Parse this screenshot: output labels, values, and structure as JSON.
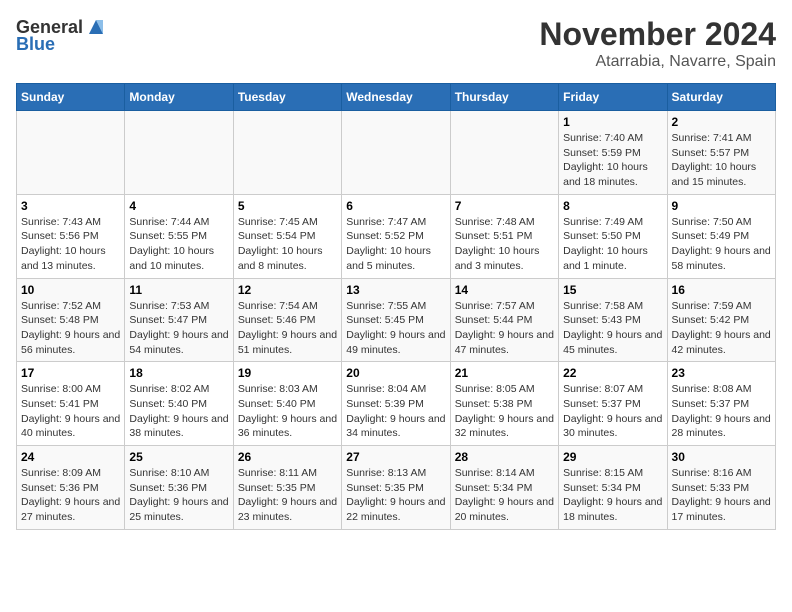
{
  "header": {
    "logo_general": "General",
    "logo_blue": "Blue",
    "month": "November 2024",
    "location": "Atarrabia, Navarre, Spain"
  },
  "weekdays": [
    "Sunday",
    "Monday",
    "Tuesday",
    "Wednesday",
    "Thursday",
    "Friday",
    "Saturday"
  ],
  "weeks": [
    [
      {
        "day": "",
        "info": ""
      },
      {
        "day": "",
        "info": ""
      },
      {
        "day": "",
        "info": ""
      },
      {
        "day": "",
        "info": ""
      },
      {
        "day": "",
        "info": ""
      },
      {
        "day": "1",
        "info": "Sunrise: 7:40 AM\nSunset: 5:59 PM\nDaylight: 10 hours and 18 minutes."
      },
      {
        "day": "2",
        "info": "Sunrise: 7:41 AM\nSunset: 5:57 PM\nDaylight: 10 hours and 15 minutes."
      }
    ],
    [
      {
        "day": "3",
        "info": "Sunrise: 7:43 AM\nSunset: 5:56 PM\nDaylight: 10 hours and 13 minutes."
      },
      {
        "day": "4",
        "info": "Sunrise: 7:44 AM\nSunset: 5:55 PM\nDaylight: 10 hours and 10 minutes."
      },
      {
        "day": "5",
        "info": "Sunrise: 7:45 AM\nSunset: 5:54 PM\nDaylight: 10 hours and 8 minutes."
      },
      {
        "day": "6",
        "info": "Sunrise: 7:47 AM\nSunset: 5:52 PM\nDaylight: 10 hours and 5 minutes."
      },
      {
        "day": "7",
        "info": "Sunrise: 7:48 AM\nSunset: 5:51 PM\nDaylight: 10 hours and 3 minutes."
      },
      {
        "day": "8",
        "info": "Sunrise: 7:49 AM\nSunset: 5:50 PM\nDaylight: 10 hours and 1 minute."
      },
      {
        "day": "9",
        "info": "Sunrise: 7:50 AM\nSunset: 5:49 PM\nDaylight: 9 hours and 58 minutes."
      }
    ],
    [
      {
        "day": "10",
        "info": "Sunrise: 7:52 AM\nSunset: 5:48 PM\nDaylight: 9 hours and 56 minutes."
      },
      {
        "day": "11",
        "info": "Sunrise: 7:53 AM\nSunset: 5:47 PM\nDaylight: 9 hours and 54 minutes."
      },
      {
        "day": "12",
        "info": "Sunrise: 7:54 AM\nSunset: 5:46 PM\nDaylight: 9 hours and 51 minutes."
      },
      {
        "day": "13",
        "info": "Sunrise: 7:55 AM\nSunset: 5:45 PM\nDaylight: 9 hours and 49 minutes."
      },
      {
        "day": "14",
        "info": "Sunrise: 7:57 AM\nSunset: 5:44 PM\nDaylight: 9 hours and 47 minutes."
      },
      {
        "day": "15",
        "info": "Sunrise: 7:58 AM\nSunset: 5:43 PM\nDaylight: 9 hours and 45 minutes."
      },
      {
        "day": "16",
        "info": "Sunrise: 7:59 AM\nSunset: 5:42 PM\nDaylight: 9 hours and 42 minutes."
      }
    ],
    [
      {
        "day": "17",
        "info": "Sunrise: 8:00 AM\nSunset: 5:41 PM\nDaylight: 9 hours and 40 minutes."
      },
      {
        "day": "18",
        "info": "Sunrise: 8:02 AM\nSunset: 5:40 PM\nDaylight: 9 hours and 38 minutes."
      },
      {
        "day": "19",
        "info": "Sunrise: 8:03 AM\nSunset: 5:40 PM\nDaylight: 9 hours and 36 minutes."
      },
      {
        "day": "20",
        "info": "Sunrise: 8:04 AM\nSunset: 5:39 PM\nDaylight: 9 hours and 34 minutes."
      },
      {
        "day": "21",
        "info": "Sunrise: 8:05 AM\nSunset: 5:38 PM\nDaylight: 9 hours and 32 minutes."
      },
      {
        "day": "22",
        "info": "Sunrise: 8:07 AM\nSunset: 5:37 PM\nDaylight: 9 hours and 30 minutes."
      },
      {
        "day": "23",
        "info": "Sunrise: 8:08 AM\nSunset: 5:37 PM\nDaylight: 9 hours and 28 minutes."
      }
    ],
    [
      {
        "day": "24",
        "info": "Sunrise: 8:09 AM\nSunset: 5:36 PM\nDaylight: 9 hours and 27 minutes."
      },
      {
        "day": "25",
        "info": "Sunrise: 8:10 AM\nSunset: 5:36 PM\nDaylight: 9 hours and 25 minutes."
      },
      {
        "day": "26",
        "info": "Sunrise: 8:11 AM\nSunset: 5:35 PM\nDaylight: 9 hours and 23 minutes."
      },
      {
        "day": "27",
        "info": "Sunrise: 8:13 AM\nSunset: 5:35 PM\nDaylight: 9 hours and 22 minutes."
      },
      {
        "day": "28",
        "info": "Sunrise: 8:14 AM\nSunset: 5:34 PM\nDaylight: 9 hours and 20 minutes."
      },
      {
        "day": "29",
        "info": "Sunrise: 8:15 AM\nSunset: 5:34 PM\nDaylight: 9 hours and 18 minutes."
      },
      {
        "day": "30",
        "info": "Sunrise: 8:16 AM\nSunset: 5:33 PM\nDaylight: 9 hours and 17 minutes."
      }
    ]
  ]
}
